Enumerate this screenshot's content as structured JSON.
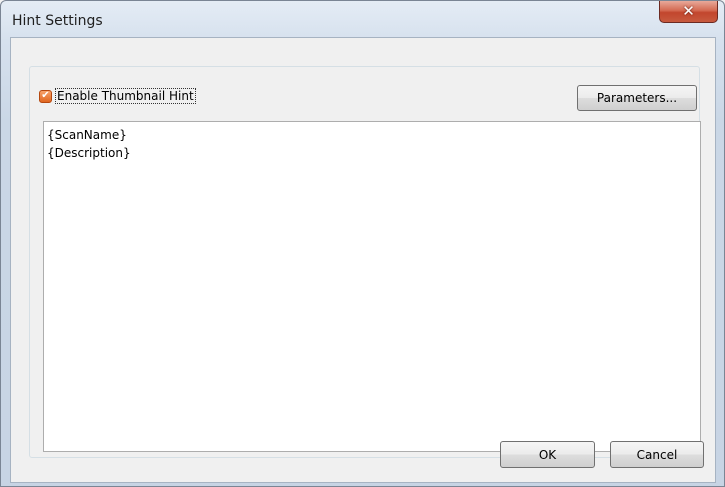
{
  "window": {
    "title": "Hint Settings",
    "close_glyph": "✕"
  },
  "options": {
    "enable_label": "Enable Thumbnail Hint",
    "enable_checked": true,
    "check_glyph": "✔",
    "parameters_label": "Parameters..."
  },
  "template": {
    "text": "{ScanName}\n{Description}"
  },
  "footer": {
    "ok_label": "OK",
    "cancel_label": "Cancel"
  },
  "colors": {
    "close_button": "#c75a3f",
    "checkbox_accent": "#e0661f"
  }
}
